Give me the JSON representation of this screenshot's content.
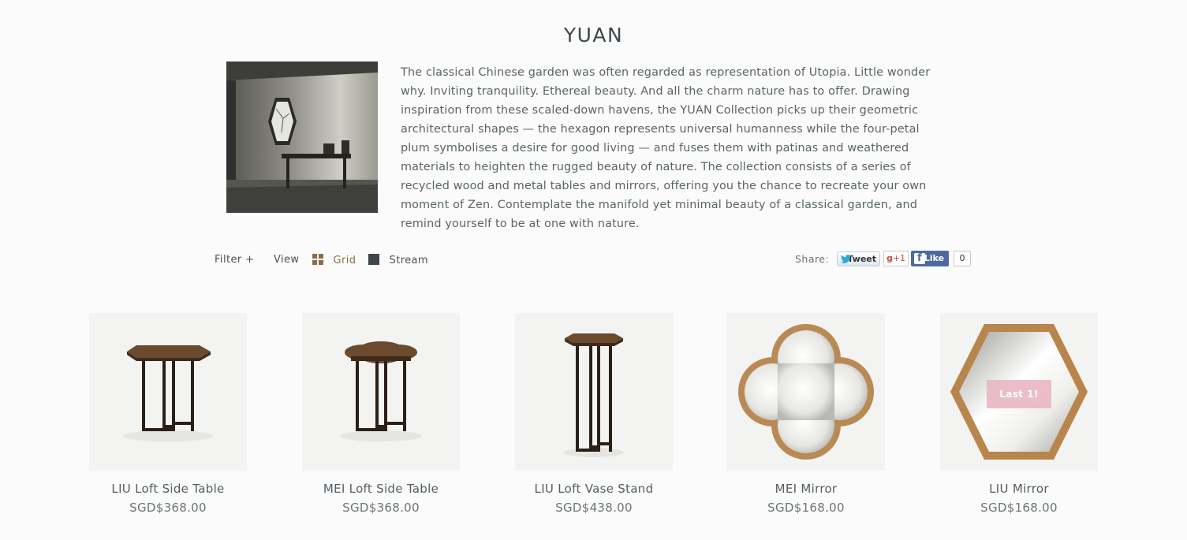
{
  "collection": {
    "title": "YUAN",
    "description": "The classical Chinese garden was often regarded as representation of Utopia. Little wonder why. Inviting tranquility. Ethereal beauty. And all the charm nature has to offer. Drawing inspiration from these scaled-down havens, the YUAN Collection picks up their geometric architectural shapes — the hexagon represents universal humanness while the four-petal plum symbolises a desire for good living — and fuses them with patinas and weathered materials to heighten the rugged beauty of nature. The collection consists of a series of recycled wood and metal tables and mirrors, offering you the chance to recreate your own moment of Zen. Contemplate the manifold yet minimal beauty of a classical garden, and remind yourself to be at one with nature."
  },
  "toolbar": {
    "filter_label": "Filter +",
    "view_label": "View",
    "grid_label": "Grid",
    "stream_label": "Stream",
    "grid_icon_color": "#8a6d4a",
    "stream_icon_color": "#3e474c"
  },
  "share": {
    "label": "Share:",
    "tweet_label": "Tweet",
    "gplus_label": "+1",
    "like_label": "Like",
    "like_count": "0"
  },
  "products": [
    {
      "name": "LIU Loft Side Table",
      "price": "SGD$368.00",
      "icon": "hexagon-side-table"
    },
    {
      "name": "MEI Loft Side Table",
      "price": "SGD$368.00",
      "icon": "plum-side-table"
    },
    {
      "name": "LIU Loft Vase Stand",
      "price": "SGD$438.00",
      "icon": "hexagon-vase-stand"
    },
    {
      "name": "MEI Mirror",
      "price": "SGD$168.00",
      "icon": "plum-mirror"
    },
    {
      "name": "LIU Mirror",
      "price": "SGD$168.00",
      "icon": "hexagon-mirror",
      "badge": "Last 1!"
    }
  ]
}
